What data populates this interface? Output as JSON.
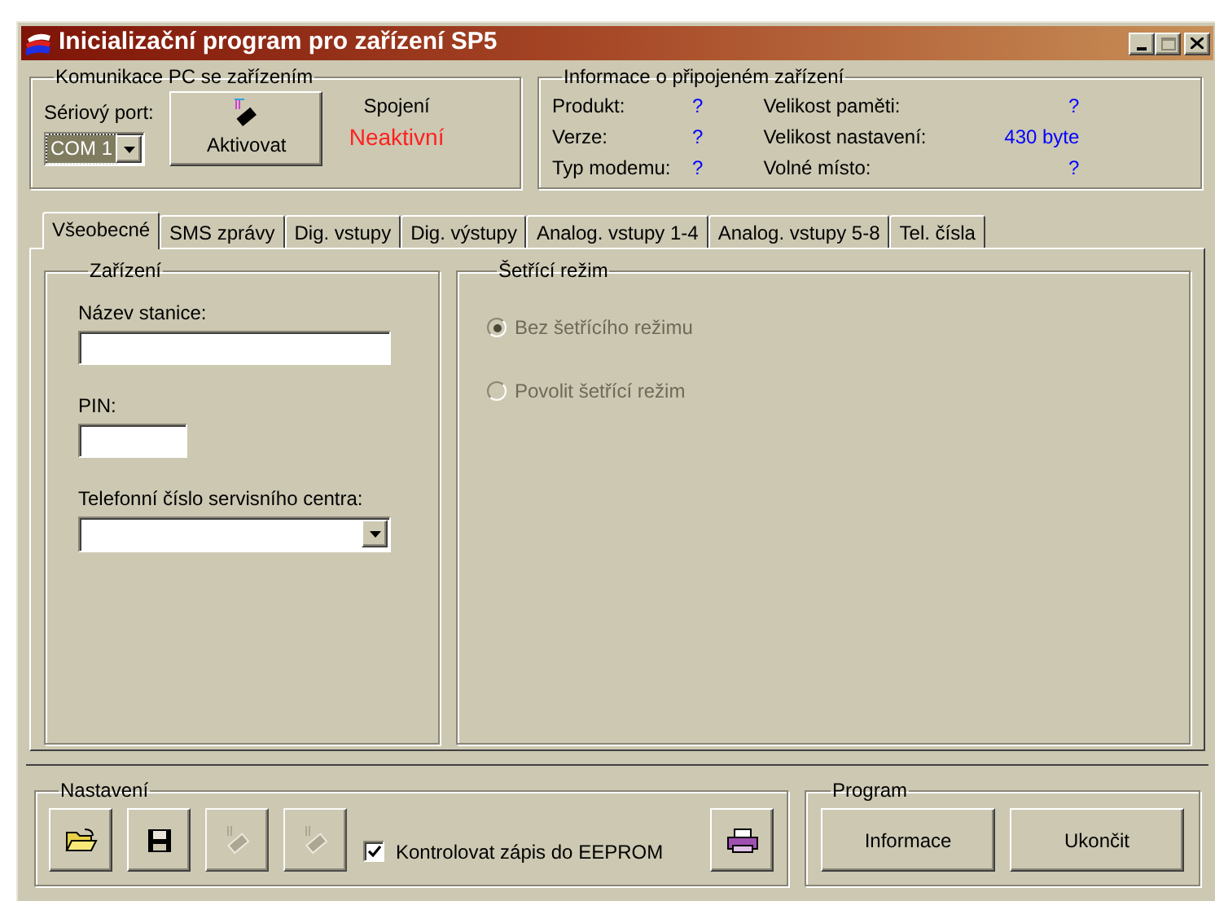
{
  "window": {
    "title": "Inicializační program pro zařízení SP5"
  },
  "communication": {
    "title": "Komunikace PC se zařízením",
    "port_label": "Sériový port:",
    "port_value": "COM 1",
    "activate_button": "Aktivovat",
    "connection_label": "Spojení",
    "connection_status": "Neaktivní"
  },
  "device_info": {
    "title": "Informace o připojeném zařízení",
    "left_fields": [
      {
        "label": "Produkt:",
        "value": "?"
      },
      {
        "label": "Verze:",
        "value": "?"
      },
      {
        "label": "Typ modemu:",
        "value": "?"
      }
    ],
    "right_fields": [
      {
        "label": "Velikost paměti:",
        "value": "?"
      },
      {
        "label": "Velikost nastavení:",
        "value": "430 byte"
      },
      {
        "label": "Volné místo:",
        "value": "?"
      }
    ]
  },
  "tabs": [
    {
      "label": "Všeobecné",
      "selected": true
    },
    {
      "label": "SMS zprávy",
      "selected": false
    },
    {
      "label": "Dig. vstupy",
      "selected": false
    },
    {
      "label": "Dig. výstupy",
      "selected": false
    },
    {
      "label": "Analog. vstupy 1-4",
      "selected": false
    },
    {
      "label": "Analog. vstupy 5-8",
      "selected": false
    },
    {
      "label": "Tel. čísla",
      "selected": false
    }
  ],
  "device": {
    "title": "Zařízení",
    "fields": [
      {
        "kind": "text",
        "label": "Název stanice:"
      },
      {
        "kind": "short",
        "label": "PIN:"
      },
      {
        "kind": "combo",
        "label": "Telefonní číslo servisního centra:"
      }
    ]
  },
  "power_saving": {
    "title": "Šetřící režim",
    "disabled": true,
    "options": [
      {
        "label": "Bez šetřícího režimu",
        "selected": true
      },
      {
        "label": "Povolit šetřící režim",
        "selected": false
      }
    ]
  },
  "settings": {
    "title": "Nastavení",
    "tool_buttons": [
      {
        "kind": "open",
        "disabled": false
      },
      {
        "kind": "save",
        "disabled": false
      },
      {
        "kind": "read",
        "disabled": true
      },
      {
        "kind": "write",
        "disabled": true
      }
    ],
    "eeprom_check": {
      "label": "Kontrolovat zápis do EEPROM",
      "checked": true
    }
  },
  "program": {
    "title": "Program",
    "buttons": [
      "Informace",
      "Ukončit"
    ]
  }
}
